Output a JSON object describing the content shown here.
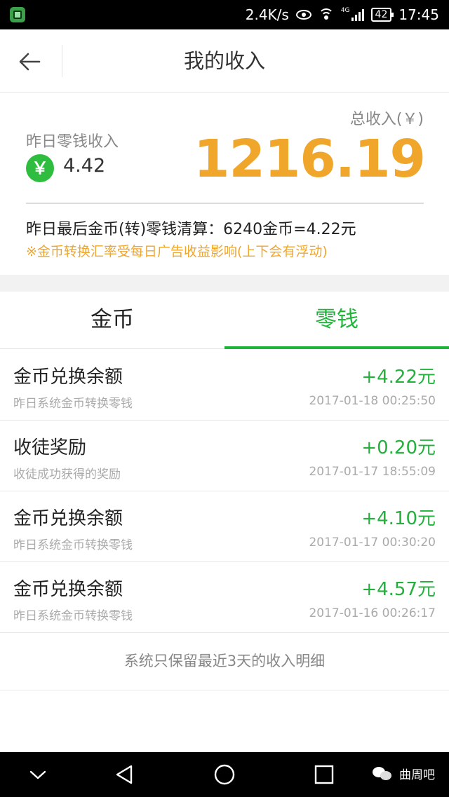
{
  "status_bar": {
    "network_speed": "2.4K/s",
    "network_type": "4G",
    "battery": "42",
    "time": "17:45"
  },
  "header": {
    "title": "我的收入"
  },
  "summary": {
    "total_label": "总收入(￥)",
    "total_value": "1216.19",
    "yesterday_label": "昨日零钱收入",
    "yen_symbol": "￥",
    "yesterday_value": "4.42",
    "settlement_text": "昨日最后金币(转)零钱清算：6240金币=4.22元",
    "settlement_note": "※金币转换汇率受每日广告收益影响(上下会有浮动)"
  },
  "tabs": [
    {
      "label": "金币",
      "active": false
    },
    {
      "label": "零钱",
      "active": true
    }
  ],
  "records": [
    {
      "title": "金币兑换余额",
      "subtitle": "昨日系统金币转换零钱",
      "amount": "+4.22元",
      "time": "2017-01-18 00:25:50"
    },
    {
      "title": "收徒奖励",
      "subtitle": "收徒成功获得的奖励",
      "amount": "+0.20元",
      "time": "2017-01-17 18:55:09"
    },
    {
      "title": "金币兑换余额",
      "subtitle": "昨日系统金币转换零钱",
      "amount": "+4.10元",
      "time": "2017-01-17 00:30:20"
    },
    {
      "title": "金币兑换余额",
      "subtitle": "昨日系统金币转换零钱",
      "amount": "+4.57元",
      "time": "2017-01-16 00:26:17"
    }
  ],
  "footer_note": "系统只保留最近3天的收入明细",
  "watermark": "曲周吧",
  "colors": {
    "accent_green": "#1fb53a",
    "amount_orange": "#f0a62b"
  },
  "icons": {
    "back": "arrow-left-icon",
    "yen": "yen-circle-icon",
    "nav_down": "chevron-down-icon",
    "nav_back": "triangle-back-icon",
    "nav_home": "circle-home-icon",
    "nav_recent": "square-recent-icon"
  }
}
